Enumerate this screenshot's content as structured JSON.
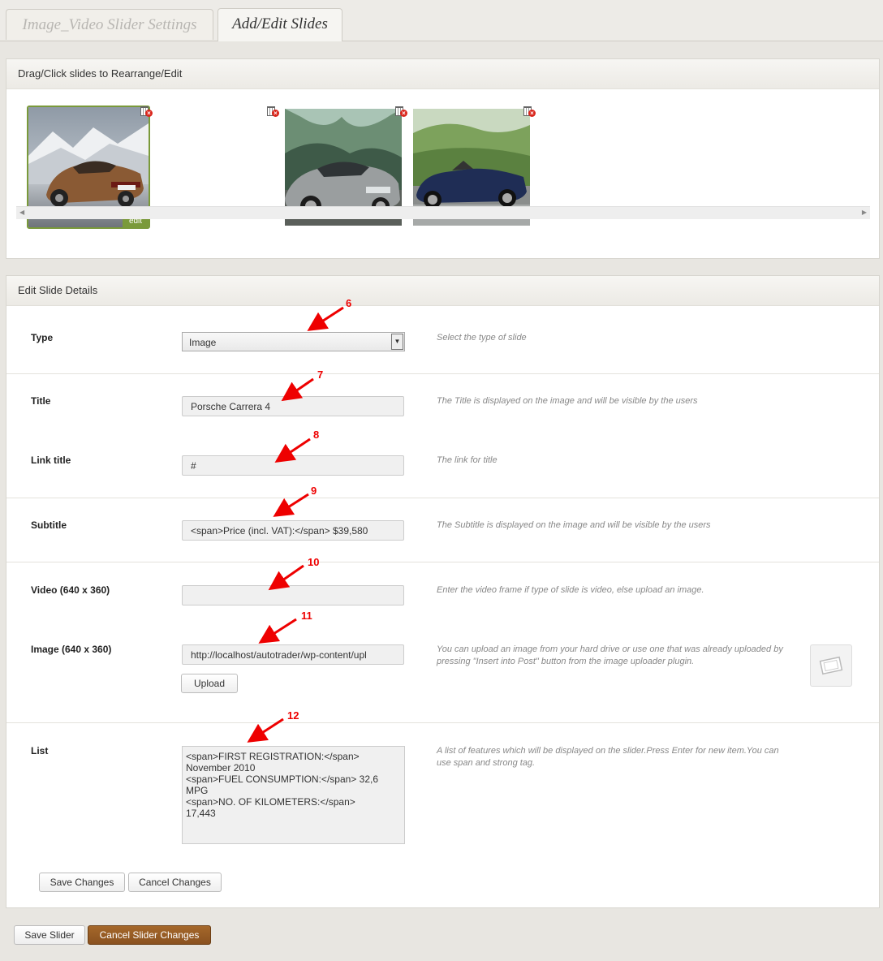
{
  "tabs": [
    {
      "label": "Image_Video Slider Settings",
      "active": false
    },
    {
      "label": "Add/Edit Slides",
      "active": true
    }
  ],
  "slides_panel": {
    "title": "Drag/Click slides to Rearrange/Edit",
    "edit_badge": "edit",
    "slides": [
      {
        "name": "porsche-slide",
        "selected": true
      },
      {
        "name": "bmw-sedan-slide",
        "selected": false
      },
      {
        "name": "bmw-roadster-slide",
        "selected": false
      }
    ]
  },
  "details_panel": {
    "title": "Edit Slide Details",
    "type": {
      "label": "Type",
      "value": "Image",
      "help": "Select the type of slide"
    },
    "title_field": {
      "label": "Title",
      "value": "Porsche Carrera 4",
      "help": "The Title is displayed on the image and will be visible by the users"
    },
    "link_title": {
      "label": "Link title",
      "value": "#",
      "help": "The link for title"
    },
    "subtitle": {
      "label": "Subtitle",
      "value": "<span>Price (incl. VAT):</span> $39,580",
      "help": "The Subtitle is displayed on the image and will be visible by the users"
    },
    "video": {
      "label": "Video (640 x 360)",
      "value": "",
      "help": "Enter the video frame if type of slide is video, else upload an image."
    },
    "image": {
      "label": "Image (640 x 360)",
      "value": "http://localhost/autotrader/wp-content/upl",
      "help": "You can upload an image from your hard drive or use one that was already uploaded by pressing \"Insert into Post\" button from the image uploader plugin.",
      "upload_label": "Upload"
    },
    "list": {
      "label": "List",
      "value": "<span>FIRST REGISTRATION:</span>\nNovember 2010\n<span>FUEL CONSUMPTION:</span> 32,6\nMPG\n<span>NO. OF KILOMETERS:</span>\n17,443",
      "help": "A list of features which will be displayed on the slider.Press Enter for new item.You can use span and strong tag."
    },
    "save_changes": "Save Changes",
    "cancel_changes": "Cancel Changes"
  },
  "annotations": [
    "6",
    "7",
    "8",
    "9",
    "10",
    "11",
    "12"
  ],
  "footer": {
    "save_slider": "Save Slider",
    "cancel_slider": "Cancel Slider Changes"
  },
  "colors": {
    "accent": "#8a5220",
    "selected_border": "#7a9a3a",
    "annotation": "#e00000"
  }
}
